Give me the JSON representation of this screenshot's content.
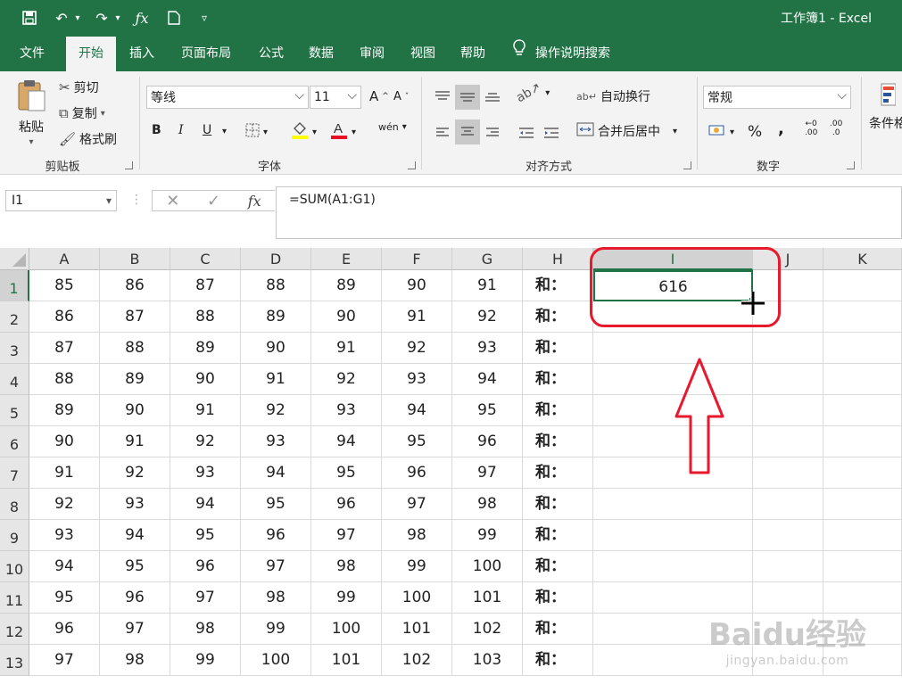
{
  "window": {
    "title": "工作簿1  -  Excel"
  },
  "quick_access": {
    "save_icon": "save-icon",
    "undo_icon": "undo-icon",
    "redo_icon": "redo-icon",
    "fx_icon": "fx-icon",
    "new_icon": "new-file-icon",
    "customize_icon": "dropdown-icon"
  },
  "tabs": [
    {
      "label": "文件"
    },
    {
      "label": "开始"
    },
    {
      "label": "插入"
    },
    {
      "label": "页面布局"
    },
    {
      "label": "公式"
    },
    {
      "label": "数据"
    },
    {
      "label": "审阅"
    },
    {
      "label": "视图"
    },
    {
      "label": "帮助"
    },
    {
      "label": "操作说明搜索"
    }
  ],
  "ribbon": {
    "clipboard": {
      "paste": "粘贴",
      "cut": "剪切",
      "copy": "复制",
      "format_painter": "格式刷",
      "label": "剪贴板"
    },
    "font": {
      "name": "等线",
      "size": "11",
      "label": "字体",
      "bold": "B",
      "italic": "I",
      "underline": "U"
    },
    "alignment": {
      "wrap": "自动换行",
      "merge": "合并后居中",
      "label": "对齐方式"
    },
    "number": {
      "format": "常规",
      "label": "数字",
      "percent": "%",
      "comma": ",",
      "inc_decimal": ".00",
      "dec_decimal": ".0"
    },
    "styles": {
      "conditional": "条件格"
    }
  },
  "formula_bar": {
    "name_box": "I1",
    "cancel": "✕",
    "confirm": "✓",
    "fx": "fx",
    "formula": "=SUM(A1:G1)"
  },
  "grid": {
    "columns": [
      "A",
      "B",
      "C",
      "D",
      "E",
      "F",
      "G",
      "H",
      "I",
      "J",
      "K"
    ],
    "rows": [
      {
        "num": "1",
        "cells": [
          "85",
          "86",
          "87",
          "88",
          "89",
          "90",
          "91",
          "和：",
          "616"
        ]
      },
      {
        "num": "2",
        "cells": [
          "86",
          "87",
          "88",
          "89",
          "90",
          "91",
          "92",
          "和：",
          ""
        ]
      },
      {
        "num": "3",
        "cells": [
          "87",
          "88",
          "89",
          "90",
          "91",
          "92",
          "93",
          "和：",
          ""
        ]
      },
      {
        "num": "4",
        "cells": [
          "88",
          "89",
          "90",
          "91",
          "92",
          "93",
          "94",
          "和：",
          ""
        ]
      },
      {
        "num": "5",
        "cells": [
          "89",
          "90",
          "91",
          "92",
          "93",
          "94",
          "95",
          "和：",
          ""
        ]
      },
      {
        "num": "6",
        "cells": [
          "90",
          "91",
          "92",
          "93",
          "94",
          "95",
          "96",
          "和：",
          ""
        ]
      },
      {
        "num": "7",
        "cells": [
          "91",
          "92",
          "93",
          "94",
          "95",
          "96",
          "97",
          "和：",
          ""
        ]
      },
      {
        "num": "8",
        "cells": [
          "92",
          "93",
          "94",
          "95",
          "96",
          "97",
          "98",
          "和：",
          ""
        ]
      },
      {
        "num": "9",
        "cells": [
          "93",
          "94",
          "95",
          "96",
          "97",
          "98",
          "99",
          "和：",
          ""
        ]
      },
      {
        "num": "10",
        "cells": [
          "94",
          "95",
          "96",
          "97",
          "98",
          "99",
          "100",
          "和：",
          ""
        ]
      },
      {
        "num": "11",
        "cells": [
          "95",
          "96",
          "97",
          "98",
          "99",
          "100",
          "101",
          "和：",
          ""
        ]
      },
      {
        "num": "12",
        "cells": [
          "96",
          "97",
          "98",
          "99",
          "100",
          "101",
          "102",
          "和：",
          ""
        ]
      },
      {
        "num": "13",
        "cells": [
          "97",
          "98",
          "99",
          "100",
          "101",
          "102",
          "103",
          "和：",
          ""
        ]
      }
    ],
    "active_cell": "I1"
  },
  "annotation": {
    "color": "#e8192c"
  },
  "watermark": {
    "text": "Baidu经验",
    "url": "jingyan.baidu.com"
  },
  "colors": {
    "excel_green": "#217346",
    "ribbon_bg": "#f3f3f3",
    "header_bg": "#e6e6e6"
  }
}
